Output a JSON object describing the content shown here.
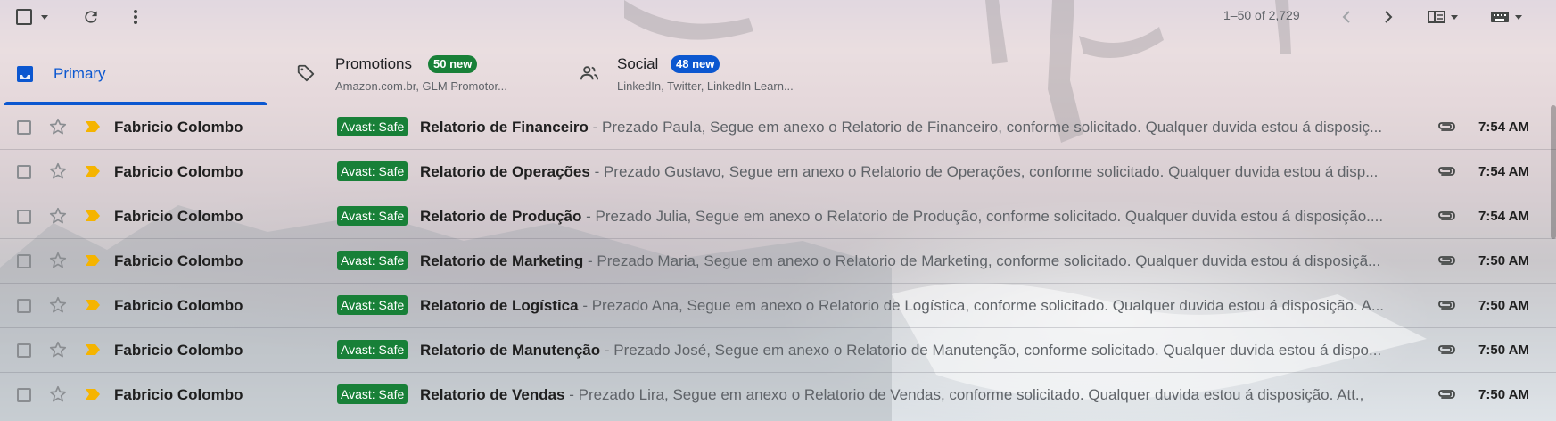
{
  "toolbar": {
    "pagination_text": "1–50 of 2,729",
    "icons": [
      "select-checkbox",
      "chevron-down-icon",
      "refresh-icon",
      "more-vert-icon",
      "chevron-left-icon",
      "chevron-right-icon",
      "split-pane-icon",
      "keyboard-icon"
    ]
  },
  "tabs": [
    {
      "label": "Primary",
      "icon": "inbox-icon",
      "selected": true
    },
    {
      "label": "Promotions",
      "icon": "tag-icon",
      "badge": "50 new",
      "badge_color": "#188038",
      "sub": "Amazon.com.br, GLM Promotor..."
    },
    {
      "label": "Social",
      "icon": "people-icon",
      "badge": "48 new",
      "badge_color": "#0b57d0",
      "sub": "LinkedIn, Twitter, LinkedIn Learn..."
    }
  ],
  "emails": [
    {
      "sender": "Fabricio Colombo",
      "tag": "Avast: Safe",
      "subject": "Relatorio de Financeiro",
      "snippet": " - Prezado Paula, Segue em anexo o Relatorio de Financeiro, conforme solicitado. Qualquer duvida estou á disposiç...",
      "time": "7:54 AM"
    },
    {
      "sender": "Fabricio Colombo",
      "tag": "Avast: Safe",
      "subject": "Relatorio de Operações",
      "snippet": " - Prezado Gustavo, Segue em anexo o Relatorio de Operações, conforme solicitado. Qualquer duvida estou á disp...",
      "time": "7:54 AM"
    },
    {
      "sender": "Fabricio Colombo",
      "tag": "Avast: Safe",
      "subject": "Relatorio de Produção",
      "snippet": " - Prezado Julia, Segue em anexo o Relatorio de Produção, conforme solicitado. Qualquer duvida estou á disposição....",
      "time": "7:54 AM"
    },
    {
      "sender": "Fabricio Colombo",
      "tag": "Avast: Safe",
      "subject": "Relatorio de Marketing",
      "snippet": " - Prezado Maria, Segue em anexo o Relatorio de Marketing, conforme solicitado. Qualquer duvida estou á disposiçã...",
      "time": "7:50 AM"
    },
    {
      "sender": "Fabricio Colombo",
      "tag": "Avast: Safe",
      "subject": "Relatorio de Logística",
      "snippet": " - Prezado Ana, Segue em anexo o Relatorio de Logística, conforme solicitado. Qualquer duvida estou á disposição. A...",
      "time": "7:50 AM"
    },
    {
      "sender": "Fabricio Colombo",
      "tag": "Avast: Safe",
      "subject": "Relatorio de Manutenção",
      "snippet": " - Prezado José, Segue em anexo o Relatorio de Manutenção, conforme solicitado. Qualquer duvida estou á dispo...",
      "time": "7:50 AM"
    },
    {
      "sender": "Fabricio Colombo",
      "tag": "Avast: Safe",
      "subject": "Relatorio de Vendas",
      "snippet": " - Prezado Lira, Segue em anexo o Relatorio de Vendas, conforme solicitado. Qualquer duvida estou á disposição. Att.,",
      "time": "7:50 AM"
    }
  ]
}
